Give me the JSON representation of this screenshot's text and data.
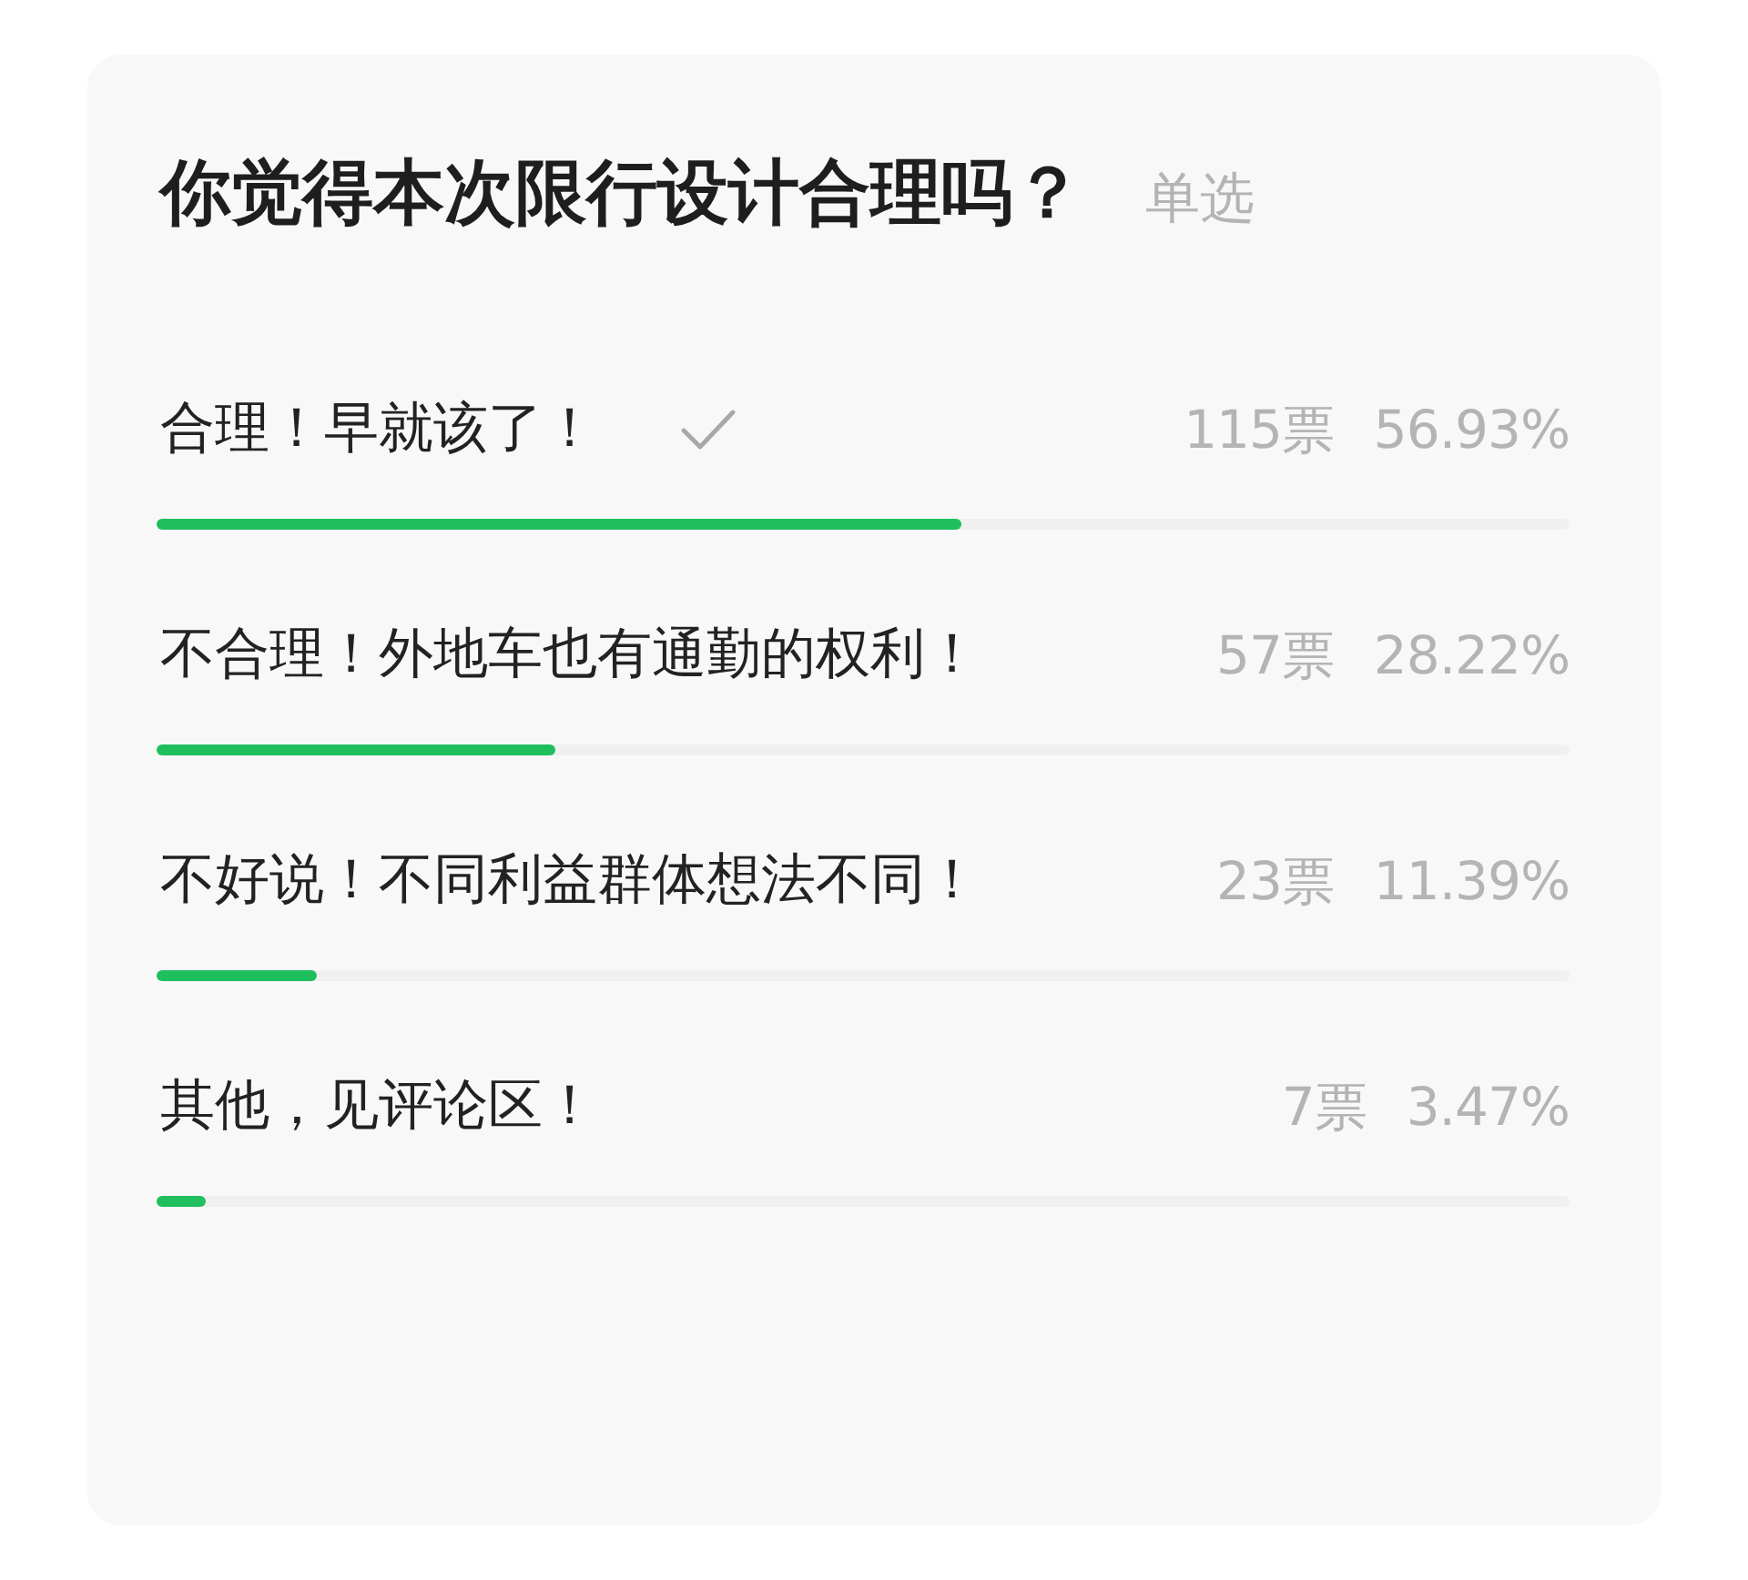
{
  "poll": {
    "question": "你觉得本次限行设计合理吗？",
    "mode": "单选",
    "options": [
      {
        "label": "合理！早就该了！",
        "selected": true,
        "votes": "115票",
        "percent": "56.93%",
        "level": 0.5693
      },
      {
        "label": "不合理！外地车也有通勤的权利！",
        "selected": false,
        "votes": "57票",
        "percent": "28.22%",
        "level": 0.2822
      },
      {
        "label": "不好说！不同利益群体想法不同！",
        "selected": false,
        "votes": "23票",
        "percent": "11.39%",
        "level": 0.1139
      },
      {
        "label": "其他，见评论区！",
        "selected": false,
        "votes": "7票",
        "percent": "3.47%",
        "level": 0.0347
      }
    ]
  }
}
